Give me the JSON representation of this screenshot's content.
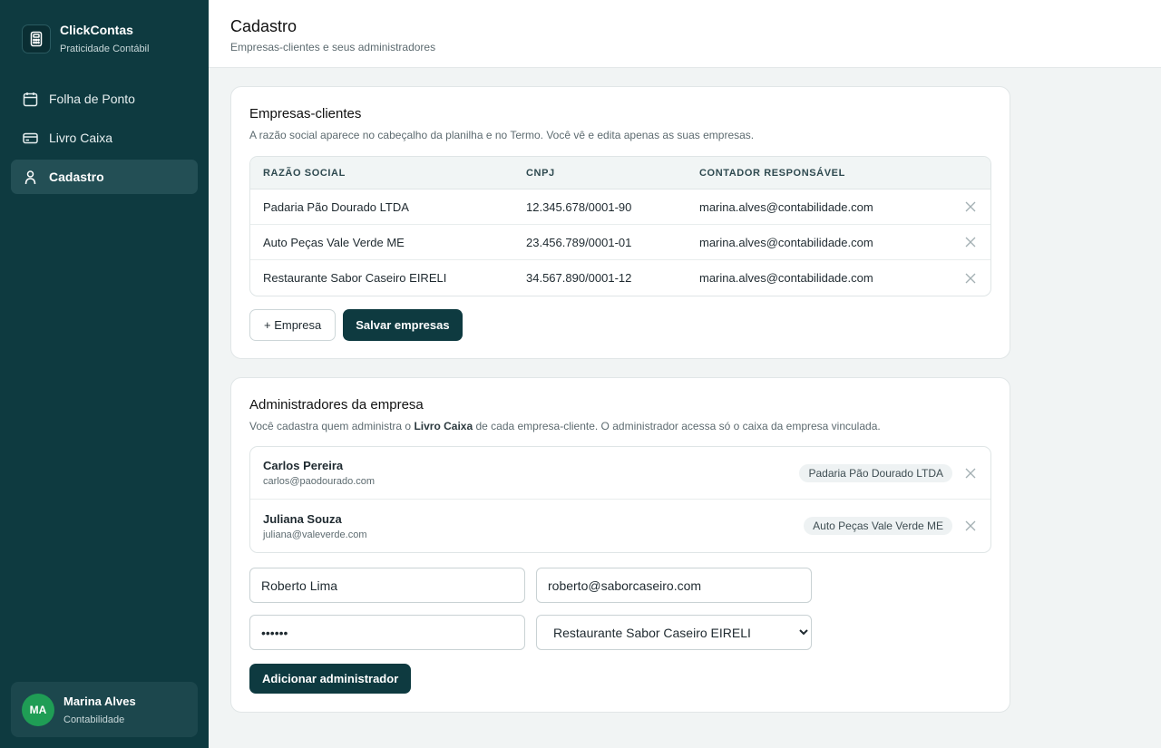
{
  "brand": {
    "name": "ClickContas",
    "tagline": "Praticidade Contábil"
  },
  "nav": [
    {
      "label": "Folha de Ponto",
      "icon": "calendar-icon"
    },
    {
      "label": "Livro Caixa",
      "icon": "card-icon"
    },
    {
      "label": "Cadastro",
      "icon": "user-icon",
      "active": true
    }
  ],
  "user": {
    "initials": "MA",
    "name": "Marina Alves",
    "role": "Contabilidade"
  },
  "header": {
    "title": "Cadastro",
    "subtitle": "Empresas-clientes e seus administradores"
  },
  "companies": {
    "title": "Empresas-clientes",
    "description": "A razão social aparece no cabeçalho da planilha e no Termo. Você vê e edita apenas as suas empresas.",
    "columns": [
      "RAZÃO SOCIAL",
      "CNPJ",
      "CONTADOR RESPONSÁVEL"
    ],
    "rows": [
      {
        "name": "Padaria Pão Dourado LTDA",
        "cnpj": "12.345.678/0001-90",
        "accountant": "marina.alves@contabilidade.com"
      },
      {
        "name": "Auto Peças Vale Verde ME",
        "cnpj": "23.456.789/0001-01",
        "accountant": "marina.alves@contabilidade.com"
      },
      {
        "name": "Restaurante Sabor Caseiro EIRELI",
        "cnpj": "34.567.890/0001-12",
        "accountant": "marina.alves@contabilidade.com"
      }
    ],
    "add_label": "+ Empresa",
    "save_label": "Salvar empresas"
  },
  "admins": {
    "title": "Administradores da empresa",
    "desc_prefix": "Você cadastra quem administra o ",
    "desc_bold": "Livro Caixa",
    "desc_suffix": " de cada empresa-cliente. O administrador acessa só o caixa da empresa vinculada.",
    "list": [
      {
        "name": "Carlos Pereira",
        "email": "carlos@paodourado.com",
        "company": "Padaria Pão Dourado LTDA"
      },
      {
        "name": "Juliana Souza",
        "email": "juliana@valeverde.com",
        "company": "Auto Peças Vale Verde ME"
      }
    ],
    "form": {
      "name_value": "Roberto Lima",
      "email_value": "roberto@saborcaseiro.com",
      "password_value": "secret",
      "company_selected": "Restaurante Sabor Caseiro EIRELI"
    },
    "add_label": "Adicionar administrador"
  },
  "colors": {
    "sidebar": "#0e3a40",
    "accent": "#0e3a40",
    "avatar": "#1f9d55"
  }
}
